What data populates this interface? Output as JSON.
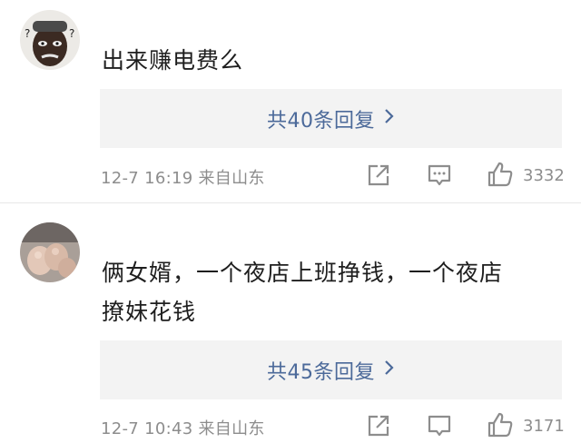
{
  "comments": [
    {
      "text": "出来赚电费么",
      "reply_label": "共40条回复",
      "meta": "12-7 16:19 来自山东",
      "likes": "3332"
    },
    {
      "text_line1": "俩女婿，一个夜店上班挣钱，一个夜店",
      "text_line2": "撩妹花钱",
      "reply_label": "共45条回复",
      "meta": "12-7 10:43 来自山东",
      "likes": "3171"
    }
  ],
  "icons": {
    "share": "share-icon",
    "comment": "comment-icon",
    "like": "thumbs-up-icon",
    "chevron": "chevron-right-icon"
  },
  "colors": {
    "link": "#4c6a9a",
    "meta": "#8d8d8d",
    "reply_bg": "#f3f3f3"
  }
}
